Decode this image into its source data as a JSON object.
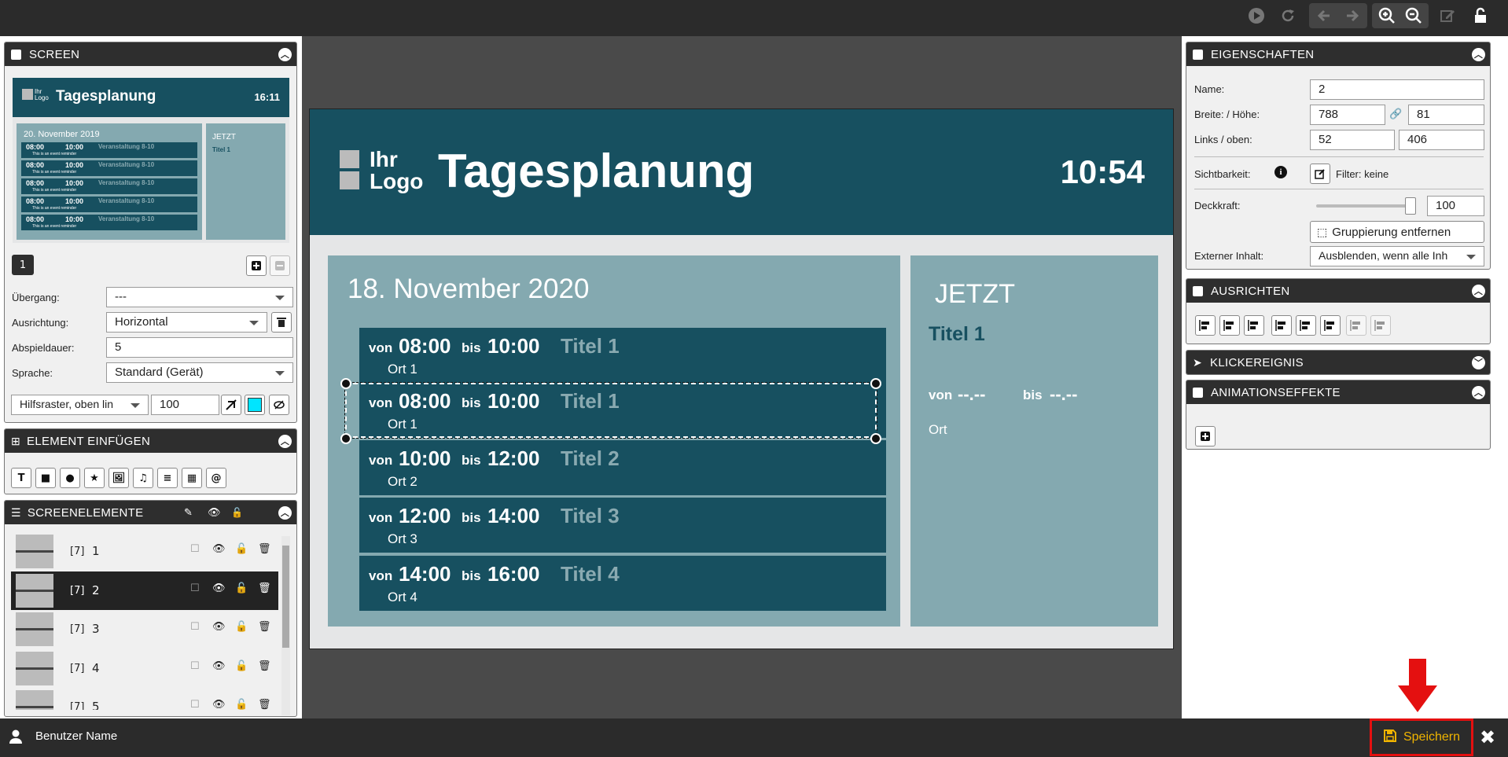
{
  "toolbar": {
    "play_icon": "play-icon",
    "refresh_icon": "refresh-icon",
    "back_icon": "arrow-left-icon",
    "forward_icon": "arrow-right-icon",
    "zoom_in_icon": "zoom-in-icon",
    "zoom_out_icon": "zoom-out-icon",
    "edit_icon": "edit-icon",
    "lock_icon": "lock-icon"
  },
  "screen_panel": {
    "title": "SCREEN",
    "preview": {
      "logo": "Ihr Logo",
      "title": "Tagesplanung",
      "time": "16:11",
      "date": "20. November 2019",
      "jetzt": "JETZT",
      "titel": "Titel 1",
      "events": [
        {
          "von": "08:00",
          "bis": "10:00",
          "title": "Veranstaltung 8-10",
          "sub": "This is an event reminder"
        },
        {
          "von": "08:00",
          "bis": "10:00",
          "title": "Veranstaltung 8-10",
          "sub": "This is an event reminder"
        },
        {
          "von": "08:00",
          "bis": "10:00",
          "title": "Veranstaltung 8-10",
          "sub": "This is an event reminder"
        },
        {
          "von": "08:00",
          "bis": "10:00",
          "title": "Veranstaltung 8-10",
          "sub": "This is an event reminder"
        },
        {
          "von": "08:00",
          "bis": "10:00",
          "title": "Veranstaltung 8-10",
          "sub": "This is an event reminder"
        }
      ]
    },
    "page_number": "1",
    "uebergang_label": "Übergang:",
    "uebergang_value": "---",
    "ausrichtung_label": "Ausrichtung:",
    "ausrichtung_value": "Horizontal",
    "abspieldauer_label": "Abspieldauer:",
    "abspieldauer_value": "5",
    "sprache_label": "Sprache:",
    "sprache_value": "Standard (Gerät)",
    "hilfsraster_value": "Hilfsraster, oben lin",
    "hilfsraster_size": "100",
    "grid_color": "#00e5ff"
  },
  "insert_panel": {
    "title": "ELEMENT EINFÜGEN",
    "tools": [
      "text-tool-icon",
      "rectangle-tool-icon",
      "circle-tool-icon",
      "star-tool-icon",
      "image-tool-icon",
      "audio-tool-icon",
      "database-tool-icon",
      "qr-tool-icon",
      "email-tool-icon"
    ]
  },
  "elements_panel": {
    "title": "SCREENELEMENTE",
    "rows": [
      {
        "tag": "[7]",
        "num": "1"
      },
      {
        "tag": "[7]",
        "num": "2"
      },
      {
        "tag": "[7]",
        "num": "3"
      },
      {
        "tag": "[7]",
        "num": "4"
      },
      {
        "tag": "[7]",
        "num": "5"
      }
    ]
  },
  "slide": {
    "logo_line1": "Ihr",
    "logo_line2": "Logo",
    "title": "Tagesplanung",
    "time": "10:54",
    "date": "18. November 2020",
    "events": [
      {
        "von": "von",
        "start": "08:00",
        "bis": "bis",
        "end": "10:00",
        "title": "Titel 1",
        "ort": "Ort 1"
      },
      {
        "von": "von",
        "start": "08:00",
        "bis": "bis",
        "end": "10:00",
        "title": "Titel 1",
        "ort": "Ort 1"
      },
      {
        "von": "von",
        "start": "10:00",
        "bis": "bis",
        "end": "12:00",
        "title": "Titel 2",
        "ort": "Ort 2"
      },
      {
        "von": "von",
        "start": "12:00",
        "bis": "bis",
        "end": "14:00",
        "title": "Titel 3",
        "ort": "Ort 3"
      },
      {
        "von": "von",
        "start": "14:00",
        "bis": "bis",
        "end": "16:00",
        "title": "Titel 4",
        "ort": "Ort 4"
      }
    ],
    "now_heading": "JETZT",
    "now_title": "Titel 1",
    "now_von": "von",
    "now_start": "--.--",
    "now_bis": "bis",
    "now_end": "--.--",
    "now_ort": "Ort",
    "colors": {
      "header": "#175060",
      "panel": "#84a9b0",
      "background": "#e5e6e7"
    }
  },
  "properties_panel": {
    "title": "EIGENSCHAFTEN",
    "name_label": "Name:",
    "name_value": "2",
    "size_label": "Breite: / Höhe:",
    "width_value": "788",
    "height_value": "81",
    "pos_label": "Links / oben:",
    "left_value": "52",
    "top_value": "406",
    "visibility_label": "Sichtbarkeit:",
    "filter_label": "Filter: keine",
    "opacity_label": "Deckkraft:",
    "opacity_value": "100",
    "opacity_level": 1.0,
    "ungroup_label": "Gruppierung entfernen",
    "external_label": "Externer Inhalt:",
    "external_value": "Ausblenden, wenn alle Inh"
  },
  "align_panel": {
    "title": "AUSRICHTEN"
  },
  "click_panel": {
    "title": "KLICKEREIGNIS"
  },
  "animation_panel": {
    "title": "ANIMATIONSEFFEKTE"
  },
  "bottom": {
    "user_name": "Benutzer Name",
    "save_label": "Speichern",
    "close_icon": "close-icon"
  }
}
